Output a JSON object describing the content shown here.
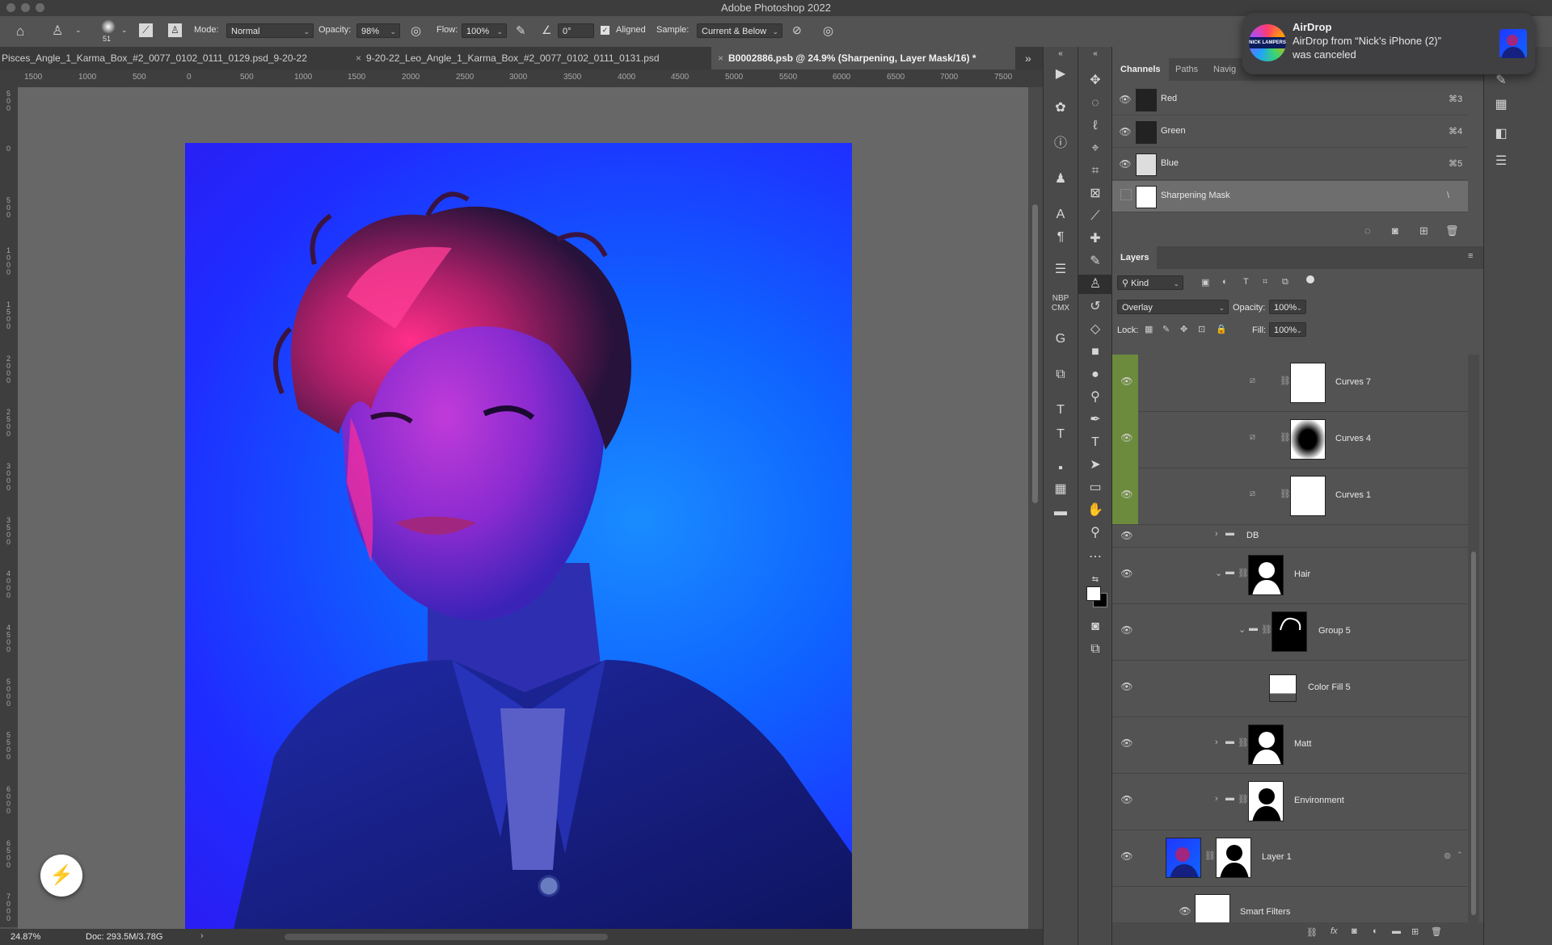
{
  "window": {
    "title": "Adobe Photoshop 2022"
  },
  "options_bar": {
    "brush_size": "51",
    "mode_label": "Mode:",
    "mode_value": "Normal",
    "opacity_label": "Opacity:",
    "opacity_value": "98%",
    "flow_label": "Flow:",
    "flow_value": "100%",
    "angle_value": "0°",
    "aligned_label": "Aligned",
    "sample_label": "Sample:",
    "sample_value": "Current & Below"
  },
  "tabs": [
    {
      "label": "9-20-22_Pisces_Angle_1_Karma_Box_#2_0077_0102_0111_0129.psd"
    },
    {
      "label": "9-20-22_Leo_Angle_1_Karma_Box_#2_0077_0102_0111_0131.psd"
    },
    {
      "label": "B0002886.psb @ 24.9% (Sharpening, Layer Mask/16) *"
    }
  ],
  "ruler": {
    "h_labels": [
      "1500",
      "1000",
      "500",
      "0",
      "500",
      "1000",
      "1500",
      "2000",
      "2500",
      "3000",
      "3500",
      "4000",
      "4500",
      "5000",
      "5500",
      "6000",
      "6500",
      "7000",
      "7500"
    ],
    "v_labels": [
      "500",
      "0",
      "500",
      "1000",
      "1500",
      "2000",
      "2500",
      "3000",
      "3500",
      "4000",
      "4500",
      "5000",
      "5500",
      "6000",
      "6500",
      "7000"
    ]
  },
  "status": {
    "zoom": "24.87%",
    "doc": "Doc: 293.5M/3.78G"
  },
  "channels_panel": {
    "tabs": [
      "Channels",
      "Paths",
      "Navig"
    ],
    "rows": [
      {
        "name": "Red",
        "shortcut": "⌘3"
      },
      {
        "name": "Green",
        "shortcut": "⌘4"
      },
      {
        "name": "Blue",
        "shortcut": "⌘5"
      },
      {
        "name": "Sharpening Mask",
        "shortcut": "\\"
      }
    ]
  },
  "layers_panel": {
    "tab": "Layers",
    "filter_kind": "Kind",
    "blend_mode": "Overlay",
    "opacity_label": "Opacity:",
    "opacity_value": "100%",
    "lock_label": "Lock:",
    "fill_label": "Fill:",
    "fill_value": "100%",
    "layers": [
      {
        "name": "Curves 7"
      },
      {
        "name": "Curves 4"
      },
      {
        "name": "Curves 1"
      },
      {
        "name": "DB"
      },
      {
        "name": "Hair"
      },
      {
        "name": "Group 5"
      },
      {
        "name": "Color Fill 5"
      },
      {
        "name": "Matt"
      },
      {
        "name": "Environment"
      },
      {
        "name": "Layer 1"
      },
      {
        "name": "Smart Filters"
      }
    ]
  },
  "notification": {
    "app_badge": "NICK LAMPERS",
    "title": "AirDrop",
    "message_line1": "AirDrop from “Nick’s iPhone (2)”",
    "message_line2": "was canceled"
  },
  "colors": {
    "accent_green": "#6c8b3c",
    "panel_bg": "#535353",
    "photo_blue": "#1f2cff"
  }
}
